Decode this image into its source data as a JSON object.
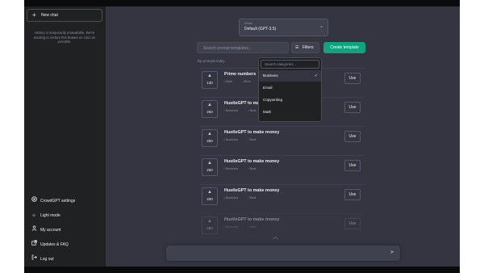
{
  "sidebar": {
    "new_chat_label": "New chat",
    "new_chat_icon": "plus-icon",
    "history_note": "History is temporarily unavailable. We're working to restore this feature as soon as possible.",
    "menu": [
      {
        "label": "CrowdGPT settings",
        "icon": "openai-logo-icon"
      },
      {
        "label": "Light mode",
        "icon": "sun-icon"
      },
      {
        "label": "My account",
        "icon": "user-icon"
      },
      {
        "label": "Updates & FAQ",
        "icon": "external-link-icon"
      },
      {
        "label": "Log out",
        "icon": "logout-icon"
      }
    ]
  },
  "model": {
    "caption": "Model",
    "value": "Default (GPT-3.5)"
  },
  "search": {
    "placeholder": "Search prompt templates..."
  },
  "filters": {
    "label": "Filters",
    "icon": "filter-icon"
  },
  "create_button": "Create template",
  "top_label": "Top prompts today",
  "dropdown": {
    "search_placeholder": "Search categories...",
    "items": [
      {
        "label": "Business",
        "selected": true
      },
      {
        "label": "Email",
        "selected": false
      },
      {
        "label": "Copywriting",
        "selected": false
      },
      {
        "label": "Math",
        "selected": false
      }
    ]
  },
  "prompts": [
    {
      "title": "Prime numbers",
      "votes": "130",
      "tags": [
        "Math",
        "Best"
      ],
      "use": "Use"
    },
    {
      "title": "HustleGPT to make money",
      "votes": "250",
      "tags": [
        "Business",
        "Best"
      ],
      "use": "Use"
    },
    {
      "title": "HustleGPT to make money",
      "votes": "250",
      "tags": [
        "Business",
        "Best"
      ],
      "use": "Use"
    },
    {
      "title": "HustleGPT to make money",
      "votes": "250",
      "tags": [
        "Business",
        "Best"
      ],
      "use": "Use"
    },
    {
      "title": "HustleGPT to make money",
      "votes": "250",
      "tags": [
        "Business",
        "Best"
      ],
      "use": "Use"
    },
    {
      "title": "HustleGPT to make money",
      "votes": "250",
      "tags": [
        "Business",
        "Best"
      ],
      "use": "Use"
    }
  ],
  "colors": {
    "accent": "#10a37f",
    "sidebar": "#202123",
    "main": "#343541",
    "input": "#40414f"
  }
}
